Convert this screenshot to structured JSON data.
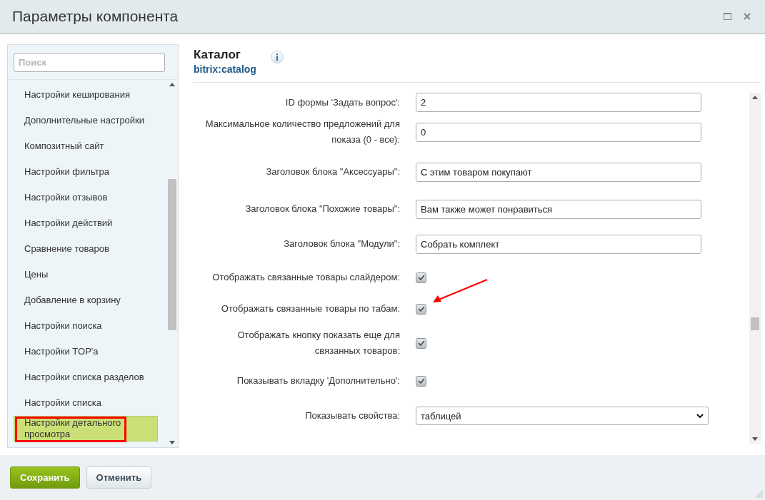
{
  "window": {
    "title": "Параметры компонента"
  },
  "sidebar": {
    "search": {
      "placeholder": "Поиск"
    },
    "items": [
      {
        "label": "Настройки кеширования",
        "selected": false
      },
      {
        "label": "Дополнительные настройки",
        "selected": false
      },
      {
        "label": "Композитный сайт",
        "selected": false
      },
      {
        "label": "Настройки фильтра",
        "selected": false
      },
      {
        "label": "Настройки отзывов",
        "selected": false
      },
      {
        "label": "Настройки действий",
        "selected": false
      },
      {
        "label": "Сравнение товаров",
        "selected": false
      },
      {
        "label": "Цены",
        "selected": false
      },
      {
        "label": "Добавление в корзину",
        "selected": false
      },
      {
        "label": "Настройки поиска",
        "selected": false
      },
      {
        "label": "Настройки TOP'а",
        "selected": false
      },
      {
        "label": "Настройки списка разделов",
        "selected": false
      },
      {
        "label": "Настройки списка",
        "selected": false
      },
      {
        "label": "Настройки детального просмотра",
        "selected": true
      }
    ]
  },
  "component": {
    "title": "Каталог",
    "code": "bitrix:catalog"
  },
  "fields": [
    {
      "kind": "text",
      "label": "ID формы 'Задать вопрос':",
      "value": "2"
    },
    {
      "kind": "text",
      "label": "Максимальное количество предложений для показа (0 - все):",
      "value": "0"
    },
    {
      "kind": "text",
      "label": "Заголовок блока \"Аксессуары\":",
      "value": "С этим товаром покупают"
    },
    {
      "kind": "text",
      "label": "Заголовок блока \"Похожие товары\":",
      "value": "Вам также может понравиться"
    },
    {
      "kind": "text",
      "label": "Заголовок блока \"Модули\":",
      "value": "Собрать комплект"
    },
    {
      "kind": "checkbox",
      "label": "Отображать связанные товары слайдером:",
      "checked": true
    },
    {
      "kind": "checkbox",
      "label": "Отображать связанные товары по табам:",
      "checked": true,
      "annotated": true
    },
    {
      "kind": "checkbox",
      "label": "Отображать кнопку показать еще для связанных товаров:",
      "checked": true
    },
    {
      "kind": "checkbox",
      "label": "Показывать вкладку 'Дополнительно':",
      "checked": true
    },
    {
      "kind": "select",
      "label": "Показывать свойства:",
      "value": "таблицей"
    }
  ],
  "buttons": [
    {
      "label": "Сохранить",
      "kind": "primary"
    },
    {
      "label": "Отменить",
      "kind": "secondary"
    }
  ]
}
